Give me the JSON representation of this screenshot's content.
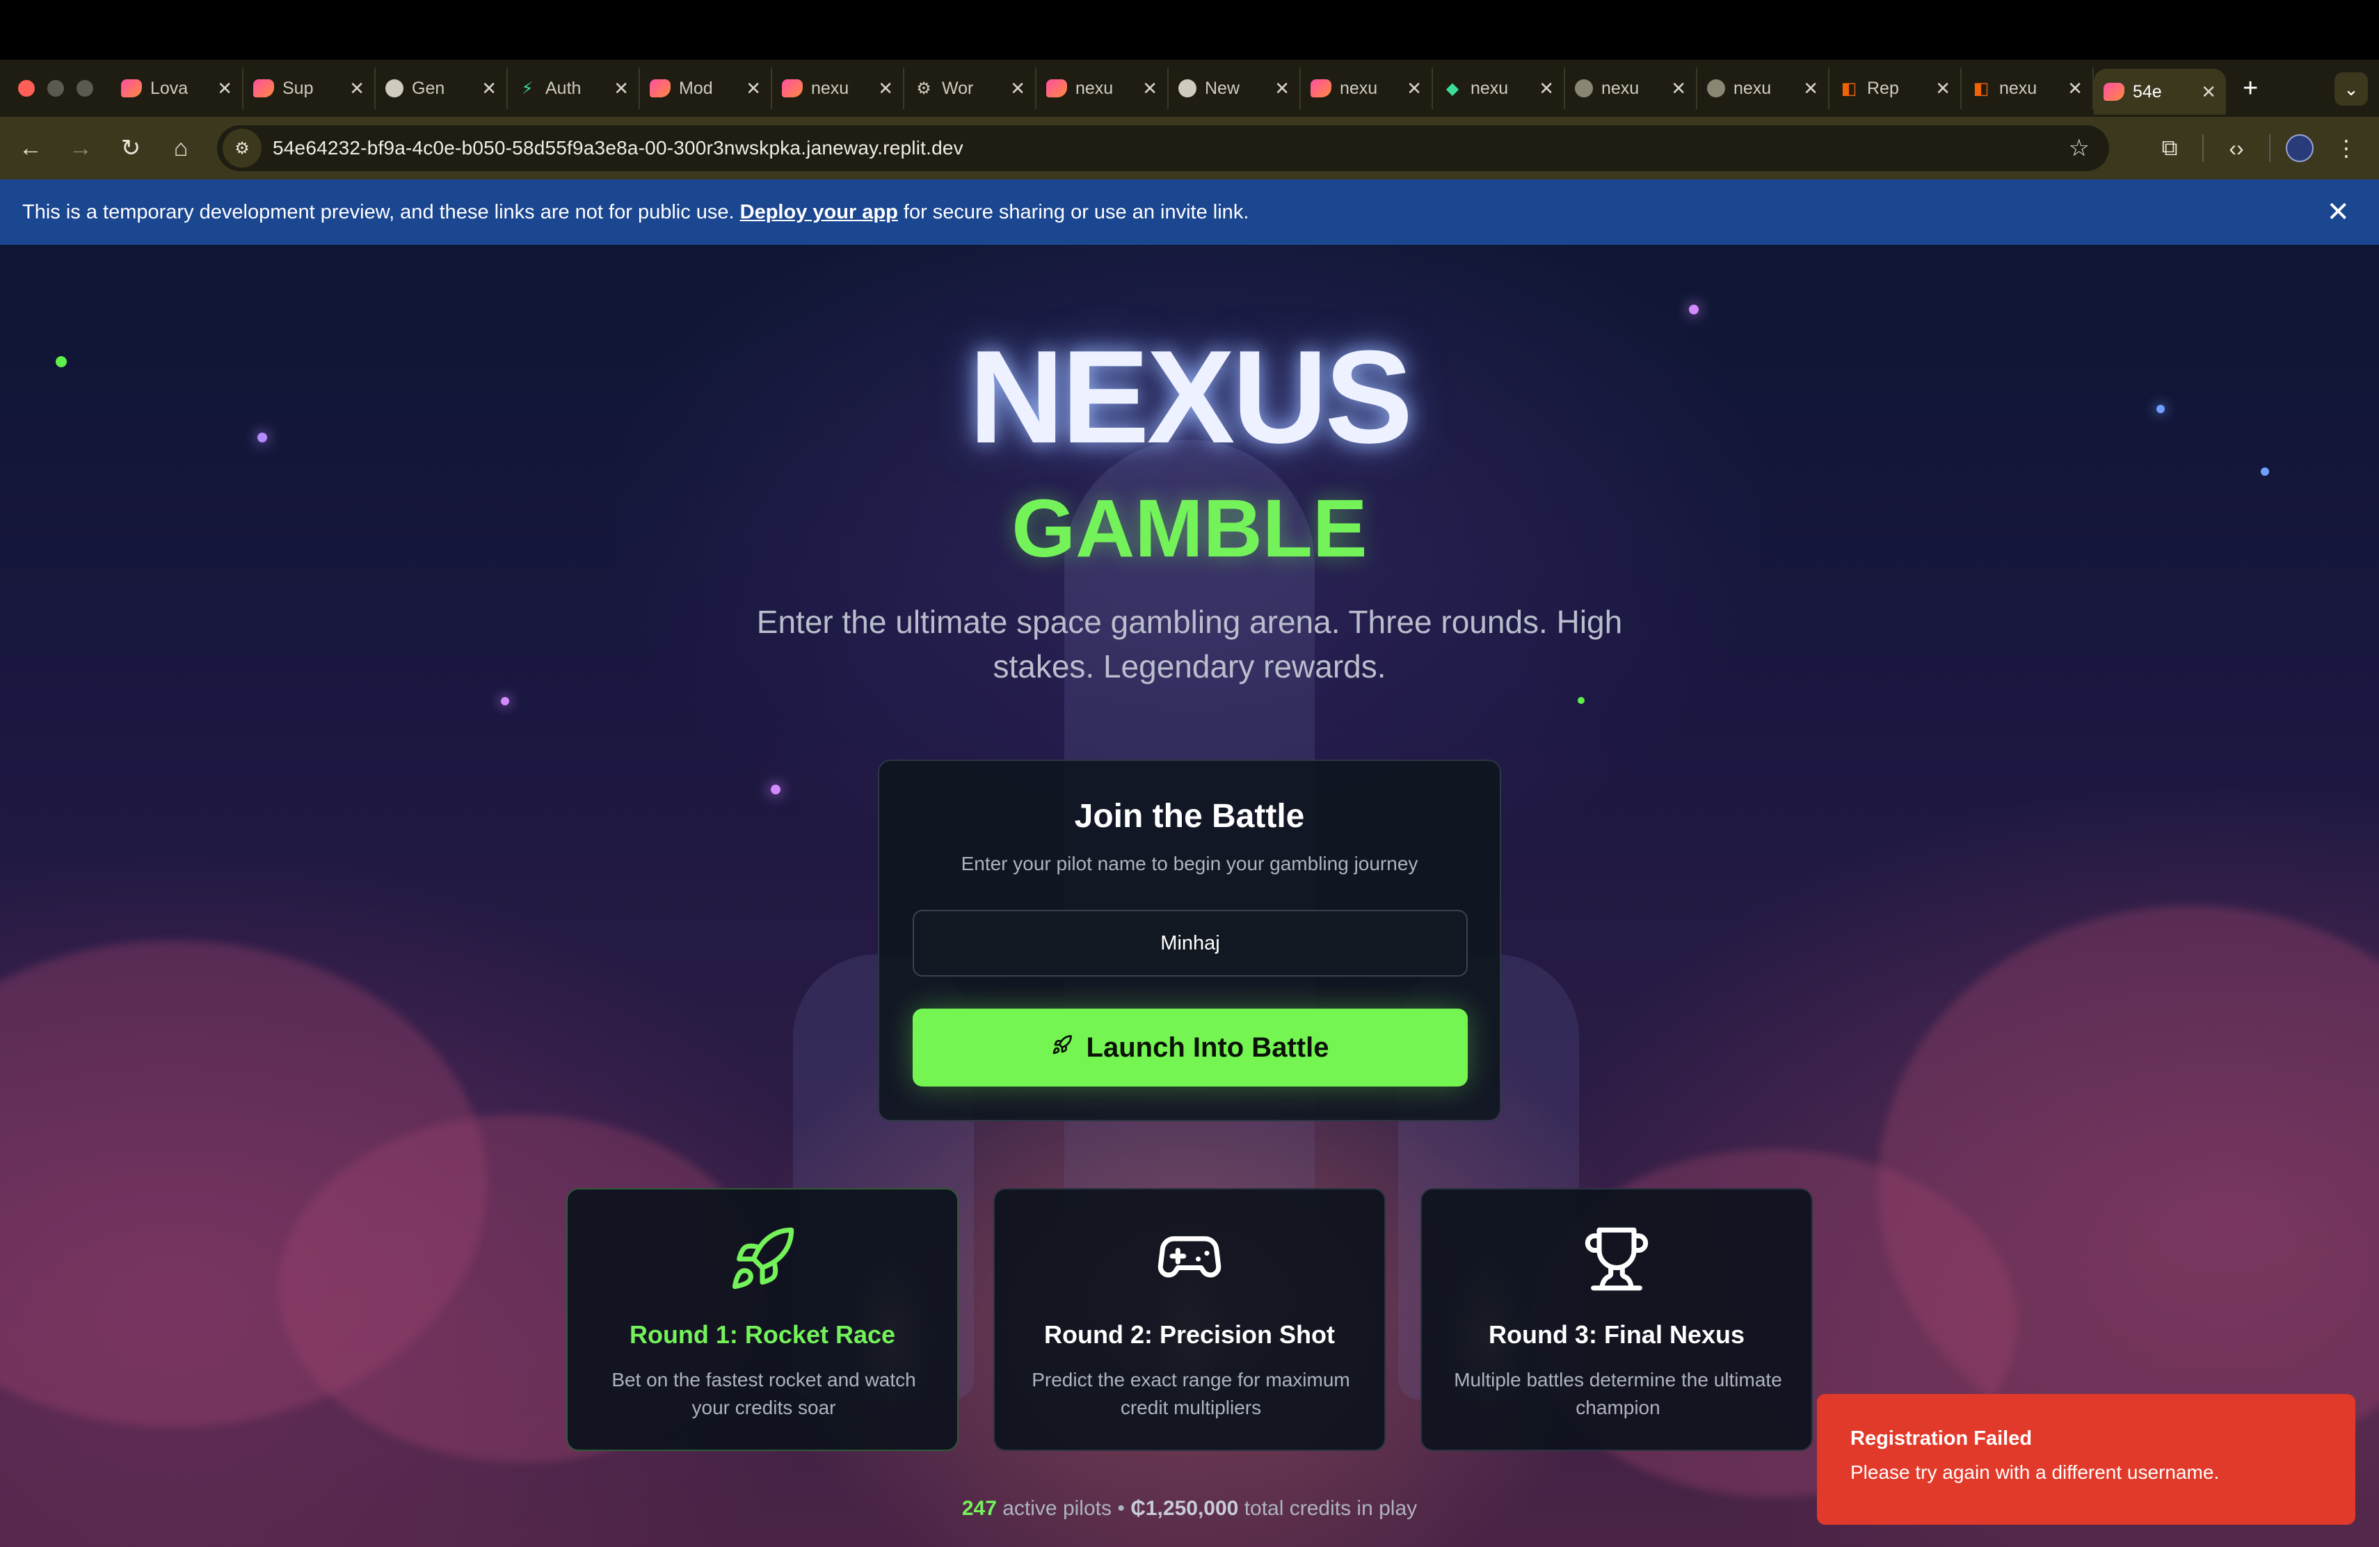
{
  "browser": {
    "tabs": [
      {
        "title": "Lova",
        "icon": "lovable-icon"
      },
      {
        "title": "Sup",
        "icon": "lovable-icon"
      },
      {
        "title": "Gen",
        "icon": "github-icon"
      },
      {
        "title": "Auth",
        "icon": "bolt-icon"
      },
      {
        "title": "Mod",
        "icon": "lovable-icon"
      },
      {
        "title": "nexu",
        "icon": "lovable-icon"
      },
      {
        "title": "Wor",
        "icon": "gear-icon"
      },
      {
        "title": "nexu",
        "icon": "lovable-icon"
      },
      {
        "title": "New",
        "icon": "chatgpt-icon"
      },
      {
        "title": "nexu",
        "icon": "lovable-icon"
      },
      {
        "title": "nexu",
        "icon": "extension-icon"
      },
      {
        "title": "nexu",
        "icon": "globe-icon"
      },
      {
        "title": "nexu",
        "icon": "globe-icon"
      },
      {
        "title": "Rep",
        "icon": "replit-icon"
      },
      {
        "title": "nexu",
        "icon": "replit-icon"
      },
      {
        "title": "54e",
        "icon": "lovable-icon",
        "active": true
      }
    ],
    "new_tab_label": "+",
    "url": "54e64232-bf9a-4c0e-b050-58d55f9a3e8a-00-300r3nwskpka.janeway.replit.dev"
  },
  "banner": {
    "text_before": "This is a temporary development preview, and these links are not for public use. ",
    "link": "Deploy your app",
    "text_after": " for secure sharing or use an invite link."
  },
  "hero": {
    "title": "NEXUS",
    "subtitle": "GAMBLE",
    "tagline": "Enter the ultimate space gambling arena. Three rounds. High stakes. Legendary rewards."
  },
  "join": {
    "title": "Join the Battle",
    "subtitle": "Enter your pilot name to begin your gambling journey",
    "input_value": "Minhaj",
    "button_label": "Launch Into Battle"
  },
  "rounds": [
    {
      "title": "Round 1: Rocket Race",
      "desc": "Bet on the fastest rocket and watch your credits soar",
      "icon": "rocket-icon"
    },
    {
      "title": "Round 2: Precision Shot",
      "desc": "Predict the exact range for maximum credit multipliers",
      "icon": "gamepad-icon"
    },
    {
      "title": "Round 3: Final Nexus",
      "desc": "Multiple battles determine the ultimate champion",
      "icon": "trophy-icon"
    }
  ],
  "stats": {
    "active_count": "247",
    "active_label": "active pilots",
    "separator": "•",
    "credits": "₵1,250,000",
    "credits_label": "total credits in play"
  },
  "toast": {
    "title": "Registration Failed",
    "message": "Please try again with a different username."
  },
  "colors": {
    "accent_green": "#74f25a",
    "banner_blue": "#1b4690",
    "toast_red": "#e23a2a"
  }
}
